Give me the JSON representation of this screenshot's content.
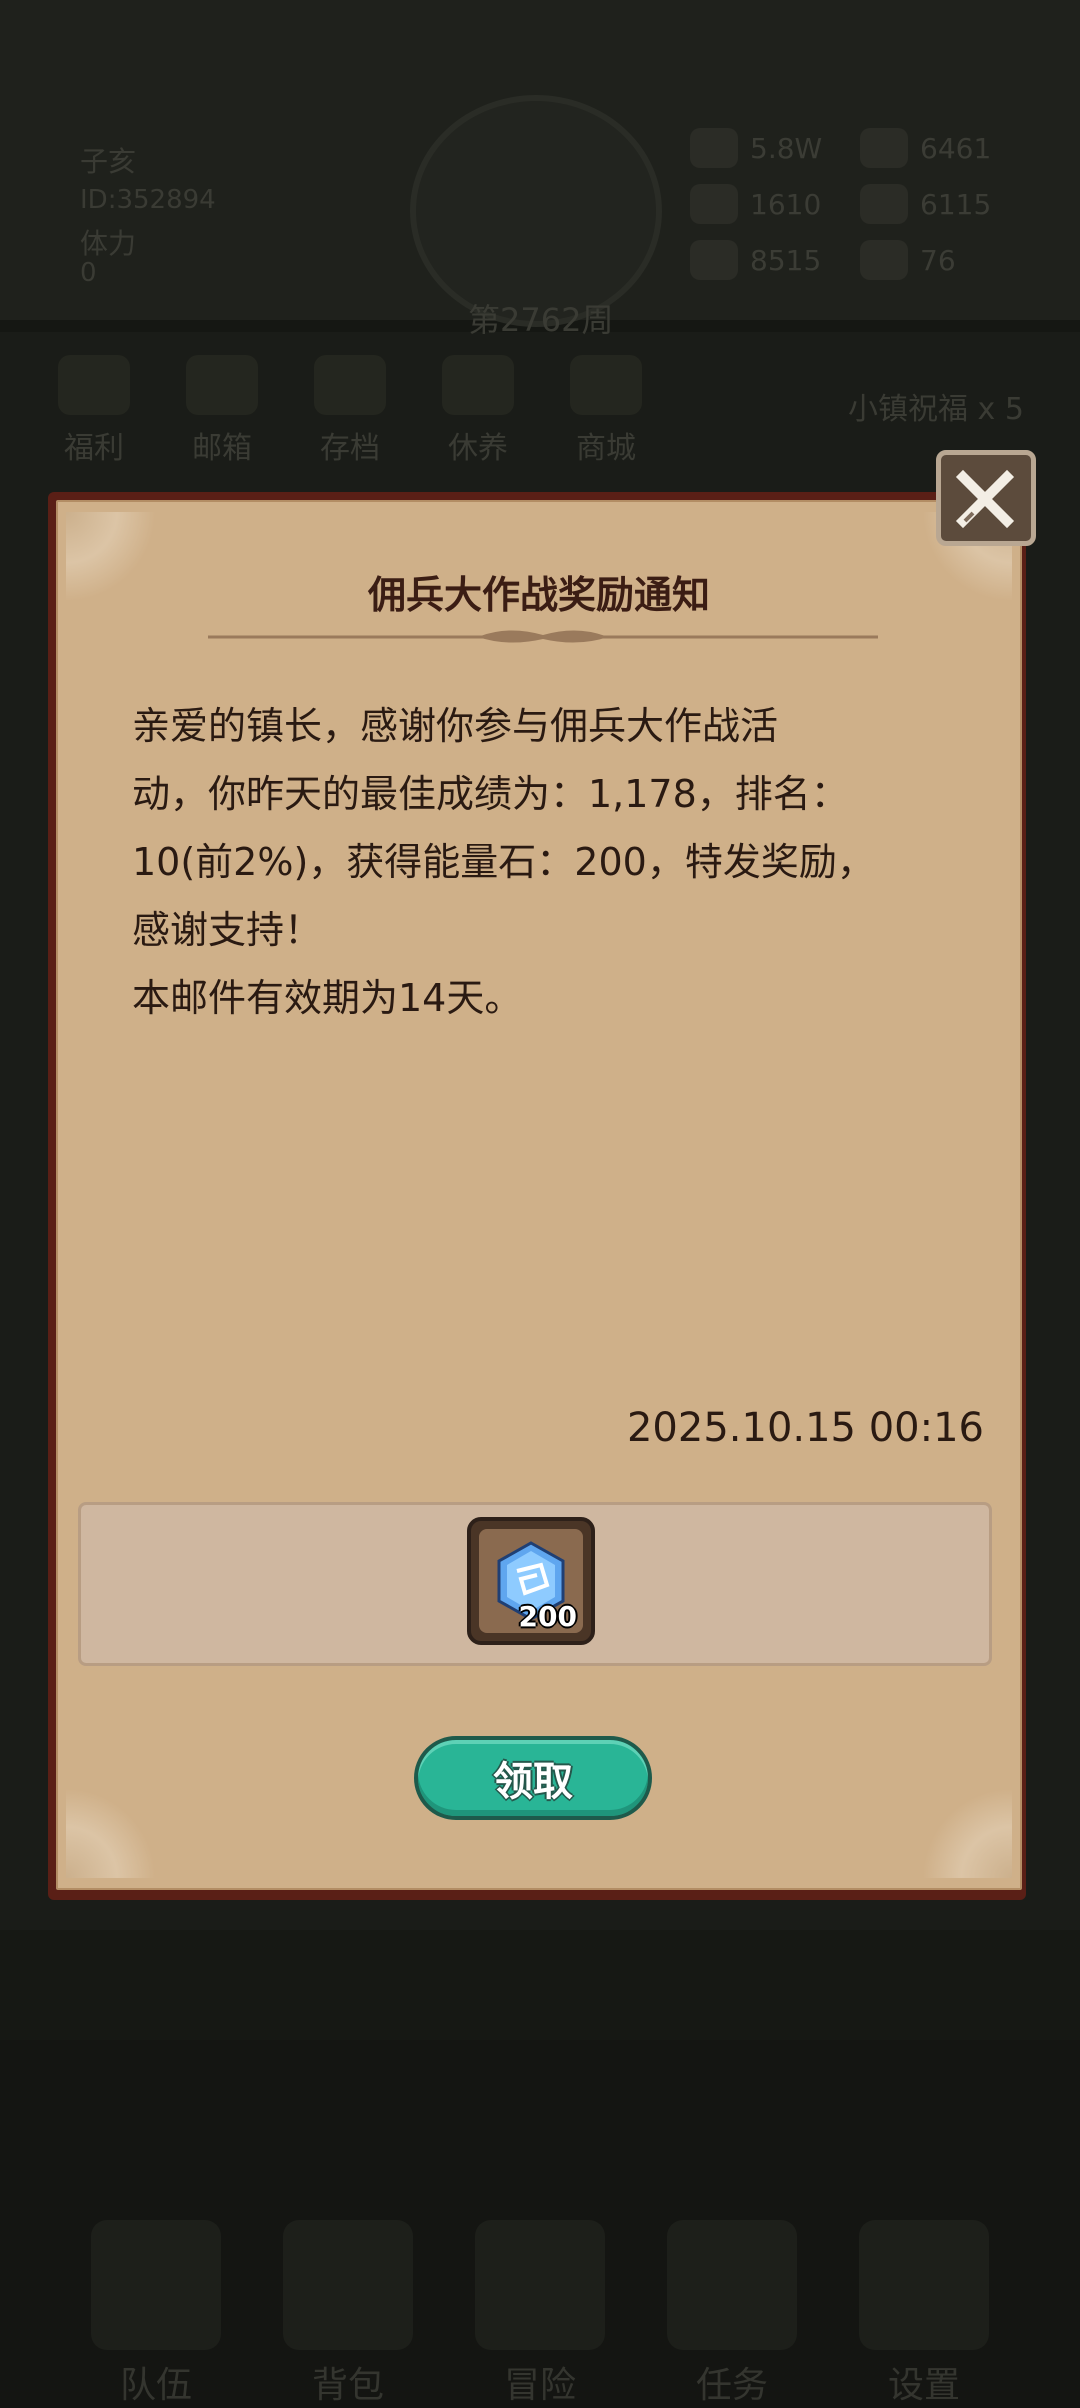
{
  "background": {
    "player": {
      "name": "子亥",
      "id_text": "ID:352894",
      "stamina_label": "体力",
      "stamina_value": "0"
    },
    "week": "第2762周",
    "resources": [
      {
        "icon": "gold-coin-icon",
        "value": "5.8W"
      },
      {
        "icon": "wood-icon",
        "value": "6461"
      },
      {
        "icon": "stone-icon",
        "value": "1610"
      },
      {
        "icon": "iron-icon",
        "value": "6115"
      },
      {
        "icon": "food-icon",
        "value": "8515"
      },
      {
        "icon": "gem-icon",
        "value": "76"
      }
    ],
    "menu": [
      "福利",
      "邮箱",
      "存档",
      "休养",
      "商城"
    ],
    "blessing": "小镇祝福 x 5",
    "bottom_nav": [
      "队伍",
      "背包",
      "冒险",
      "任务",
      "设置"
    ]
  },
  "dialog": {
    "title": "佣兵大作战奖励通知",
    "body_lines": [
      "亲爱的镇长，感谢你参与佣兵大作战活",
      "动，你昨天的最佳成绩为：1,178，排名：",
      "10(前2%)，获得能量石：200，特发奖励，",
      "感谢支持！",
      "本邮件有效期为14天。"
    ],
    "date": "2025.10.15 00:16",
    "reward": {
      "icon": "energy-stone-icon",
      "quantity": "200"
    },
    "claim_label": "领取",
    "close_icon": "close-x-icon"
  },
  "colors": {
    "panel": "#cfb089",
    "frame": "#5a1f16",
    "button": "#29b596",
    "title": "#3b1d14"
  }
}
